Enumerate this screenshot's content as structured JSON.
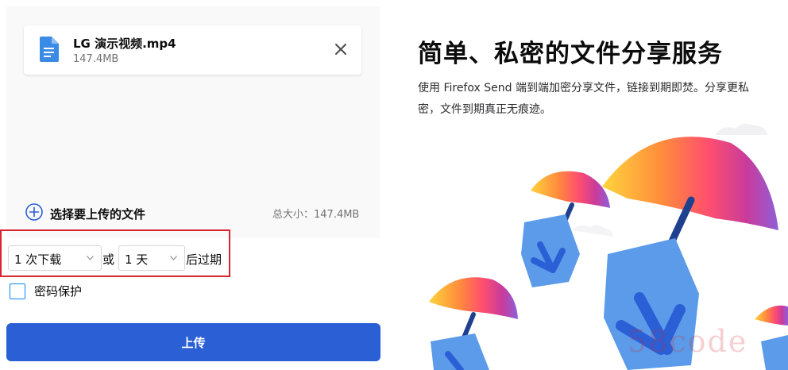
{
  "file": {
    "name": "LG 演示视频.mp4",
    "size": "147.4MB",
    "icon": "file-icon",
    "close_icon": "close-icon"
  },
  "add_files": {
    "label": "选择要上传的文件",
    "icon": "plus-circle-icon"
  },
  "total_size": "总大小：147.4MB",
  "options": {
    "downloads_selected": "1 次下载",
    "or_label": "或",
    "days_selected": "1 天",
    "after_label": "后过期"
  },
  "password": {
    "label": "密码保护",
    "checked": false
  },
  "upload_button": "上传",
  "hero": {
    "title": "简单、私密的文件分享服务",
    "description": "使用 Firefox Send 端到端加密分享文件，链接到期即焚。分享更私密，文件到期真正无痕迹。"
  },
  "watermark": "58code",
  "colors": {
    "primary": "#2a5fd6",
    "highlight_border": "#d7242e",
    "file_icon": "#3b8be6",
    "parachute_blue": "#5b9bea",
    "arrow_blue": "#2a5fd6"
  }
}
